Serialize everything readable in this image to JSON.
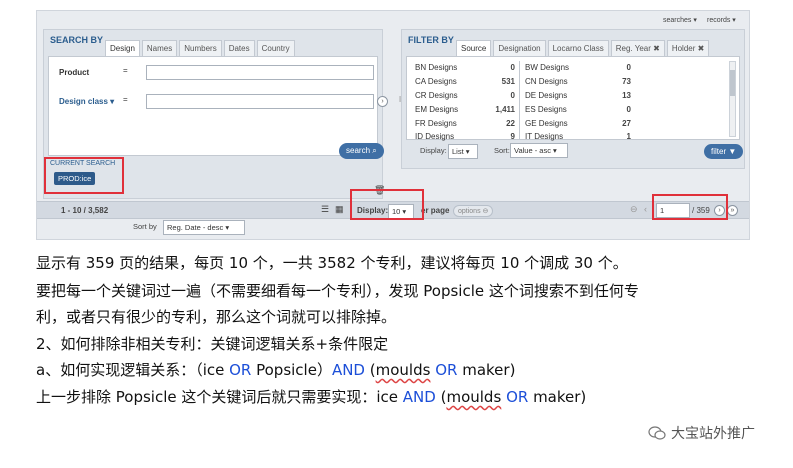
{
  "top_right": {
    "searches": "searches",
    "records": "records"
  },
  "search_panel": {
    "title": "SEARCH BY",
    "tabs": [
      "Design",
      "Names",
      "Numbers",
      "Dates",
      "Country"
    ],
    "product_label": "Product",
    "design_class_label": "Design class",
    "eq": "=",
    "search_button": "search",
    "current_search_title": "CURRENT SEARCH",
    "current_search_chip": "PROD:ice"
  },
  "filter_panel": {
    "title": "FILTER BY",
    "tabs": [
      "Source",
      "Designation",
      "Locarno Class",
      "Reg. Year",
      "Holder"
    ],
    "left_items": [
      {
        "name": "BN Designs",
        "count": "0"
      },
      {
        "name": "CA Designs",
        "count": "531"
      },
      {
        "name": "CR Designs",
        "count": "0"
      },
      {
        "name": "EM Designs",
        "count": "1,411"
      },
      {
        "name": "FR Designs",
        "count": "22"
      },
      {
        "name": "ID Designs",
        "count": "9"
      }
    ],
    "right_items": [
      {
        "name": "BW Designs",
        "count": "0"
      },
      {
        "name": "CN Designs",
        "count": "73"
      },
      {
        "name": "DE Designs",
        "count": "13"
      },
      {
        "name": "ES Designs",
        "count": "0"
      },
      {
        "name": "GE Designs",
        "count": "27"
      },
      {
        "name": "IT Designs",
        "count": "1"
      }
    ],
    "display_label": "Display:",
    "display_value": "List",
    "sort_label": "Sort:",
    "sort_value": "Value - asc",
    "filter_button": "filter"
  },
  "results_bar": {
    "range": "1 - 10 / 3,582",
    "display_label": "Display:",
    "display_value": "10",
    "per_page": "er page",
    "options": "options",
    "page_value": "1",
    "page_total": "/ 359",
    "sort_by_label": "Sort by",
    "sort_by_value": "Reg. Date - desc"
  },
  "article": {
    "line1": "显示有 359 页的结果，每页 10 个，一共 3582 个专利，建议将每页 10 个调成 30 个。",
    "line2": "要把每一个关键词过一遍（不需要细看每一个专利），发现 Popsicle 这个词搜索不到任何专",
    "line3": "利，或者只有很少的专利，那么这个词就可以排除掉。",
    "line4": "2、如何排除非相关专利：关键词逻辑关系+条件限定",
    "line5_a": "a、如何实现逻辑关系：（ice ",
    "line5_or": "OR",
    "line5_b": " Popsicle）",
    "line5_and": "AND",
    "line5_c": " (",
    "line5_moulds": "moulds",
    "line5_d": " ",
    "line5_or2": "OR",
    "line5_e": " maker)",
    "line6_a": "上一步排除 Popsicle 这个关键词后就只需要实现：ice ",
    "line6_and": "AND",
    "line6_b": " (",
    "line6_moulds": "moulds",
    "line6_c": " ",
    "line6_or": "OR",
    "line6_d": " maker)"
  },
  "watermark": "大宝站外推广",
  "colors": {
    "accent": "#2b5d8e",
    "highlight_box": "#e0303a",
    "keyword_blue": "#1c4fd8"
  }
}
